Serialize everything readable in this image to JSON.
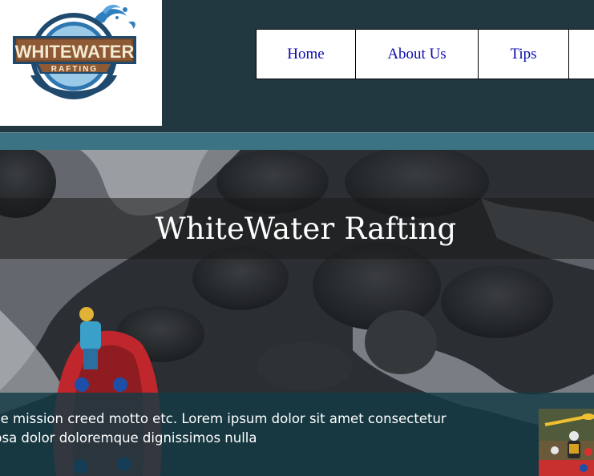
{
  "logo": {
    "line1": "WHITEWATER",
    "line2": "RAFTING"
  },
  "nav": {
    "items": [
      {
        "label": "Home"
      },
      {
        "label": "About Us"
      },
      {
        "label": "Tips"
      }
    ]
  },
  "hero": {
    "title": "WhiteWater Rafting",
    "mission_line1": "se mission creed motto etc. Lorem ipsum dolor sit amet consectetur",
    "mission_line2": "psa dolor doloremque dignissimos nulla"
  },
  "colors": {
    "header_bg": "#213841",
    "accent_band": "#3b7385",
    "nav_link": "#0b0bb0"
  }
}
